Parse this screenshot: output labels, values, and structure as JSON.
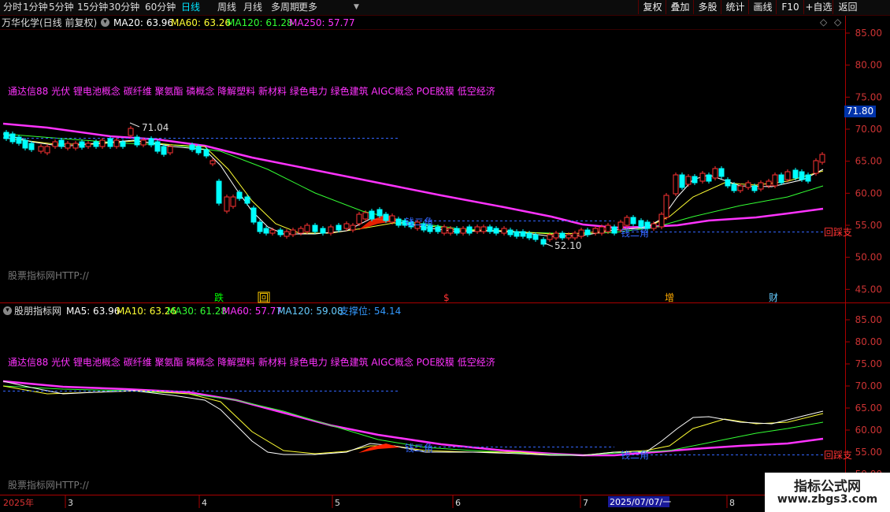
{
  "toolbar": {
    "timeframes": [
      "分时",
      "1分钟",
      "5分钟",
      "15分钟",
      "30分钟",
      "60分钟",
      "日线",
      "周线",
      "月线",
      "多周期",
      "更多"
    ],
    "active_timeframe": "日线",
    "buttons": [
      "复权",
      "叠加",
      "多股",
      "统计",
      "画线",
      "F10",
      "+自选",
      "返回"
    ]
  },
  "upper": {
    "title": "万华化学(日线 前复权)",
    "ma": [
      {
        "label": "MA20: 63.96",
        "color": "#ffffff"
      },
      {
        "label": "MA60: 63.26",
        "color": "#ffff33"
      },
      {
        "label": "MA120: 61.28",
        "color": "#33ff33"
      },
      {
        "label": "MA250: 57.77",
        "color": "#ff33ff"
      }
    ],
    "concepts": "通达信88 光伏 锂电池概念 碳纤维 聚氨酯 磷概念 降解塑料 新材料 绿色电力 绿色建筑 AIGC概念 POE胶膜 低空经济",
    "watermark": "股票指标网HTTP://",
    "y_ticks": [
      "85.00",
      "80.00",
      "75.00",
      "70.00",
      "65.00",
      "60.00",
      "55.00",
      "50.00",
      "45.00"
    ],
    "price_tag": "71.80",
    "high_label": "71.04",
    "low_label": "52.10",
    "mark_left": "钱二角",
    "mark_right": "钱二角",
    "mark_end": "回踩支",
    "events": [
      {
        "t": "跌",
        "color": "#00ff00"
      },
      {
        "t": "回",
        "color": "#ffcc00"
      },
      {
        "t": "$",
        "color": "#ff3333"
      },
      {
        "t": "增",
        "color": "#ffaa00"
      },
      {
        "t": "财",
        "color": "#66ccff"
      }
    ]
  },
  "lower": {
    "title": "股朋指标网",
    "ma": [
      {
        "label": "MA5: 63.96",
        "color": "#ffffff"
      },
      {
        "label": "MA10: 63.26",
        "color": "#ffff33"
      },
      {
        "label": "MA30: 61.28",
        "color": "#33ff33"
      },
      {
        "label": "MA60: 57.77",
        "color": "#ff33ff"
      },
      {
        "label": "MA120: 59.08",
        "color": "#66ccff"
      },
      {
        "label": "支撑位: 54.14",
        "color": "#3399ff"
      }
    ],
    "concepts": "通达信88 光伏 锂电池概念 碳纤维 聚氨酯 磷概念 降解塑料 新材料 绿色电力 绿色建筑 AIGC概念 POE胶膜 低空经济",
    "watermark": "股票指标网HTTP://",
    "y_ticks": [
      "85.00",
      "80.00",
      "75.00",
      "70.00",
      "65.00",
      "60.00",
      "55.00",
      "50.00"
    ],
    "mark_left": "钱二角",
    "mark_right": "钱二角",
    "mark_end": "回踩支"
  },
  "xaxis": {
    "year": "2025年",
    "months": [
      "3",
      "4",
      "5",
      "6",
      "7",
      "8"
    ],
    "selected_date": "2025/07/07/一"
  },
  "logo": {
    "title": "指标公式网",
    "url": "www.zbgs3.com"
  },
  "colors": {
    "up": "#ff3333",
    "down": "#00ffff",
    "ma_fast": "#ffffff",
    "ma_mid": "#ffff33",
    "ma_slow": "#33ff33",
    "ma_long": "#ff33ff",
    "support": "#3399ff"
  },
  "chart_data": {
    "type": "line",
    "title": "万华化学(日线 前复权)",
    "x": [
      "3",
      "4",
      "5",
      "6",
      "7",
      "8"
    ],
    "ylim": [
      45,
      85
    ],
    "series": [
      {
        "name": "MA20",
        "values": [
          69.0,
          68.2,
          54.0,
          54.6,
          53.6,
          63.9
        ]
      },
      {
        "name": "MA60",
        "values": [
          68.4,
          68.6,
          55.0,
          54.9,
          53.9,
          63.3
        ]
      },
      {
        "name": "MA120",
        "values": [
          69.0,
          68.0,
          59.5,
          55.3,
          54.2,
          61.3
        ]
      },
      {
        "name": "MA250",
        "values": [
          70.6,
          69.2,
          64.5,
          59.8,
          55.3,
          57.8
        ]
      }
    ]
  }
}
